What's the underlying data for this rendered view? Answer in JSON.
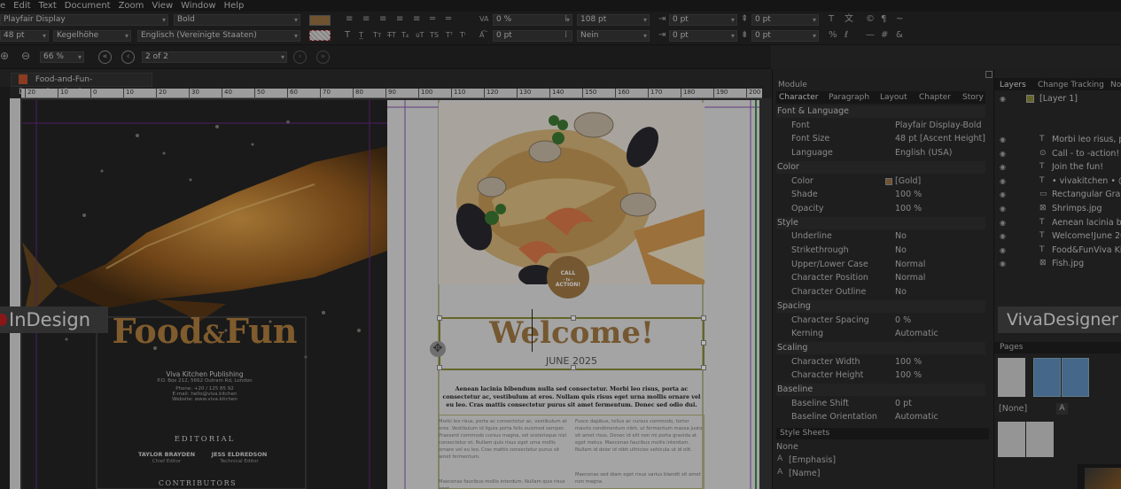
{
  "menu": [
    "Edit",
    "Text",
    "Document",
    "Zoom",
    "View",
    "Window",
    "Help"
  ],
  "menu_first_partial": "e",
  "toolbar": {
    "font": "Playfair Display",
    "style": "Bold",
    "size": "48 pt",
    "height_mode": "Kegelhöhe",
    "language": "Englisch (Vereinigte Staaten)",
    "tracking": "0 %",
    "leading": "108 pt",
    "indent1": "0 pt",
    "indent2": "0 pt",
    "indent3": "0 pt",
    "indent4": "0 pt",
    "baseline": "0 pt",
    "hyphen": "Nein",
    "swatch_color": "#9a7443"
  },
  "nav": {
    "zoom": "66 %",
    "page": "2 of 2"
  },
  "doc_tab": "Food-and-Fun-December.desd",
  "ruler_marks": [
    "20",
    "10",
    "0",
    "10",
    "20",
    "30",
    "40",
    "50",
    "60",
    "70",
    "80",
    "90",
    "100",
    "110",
    "120",
    "130",
    "140",
    "150",
    "160",
    "170",
    "180",
    "190",
    "200"
  ],
  "left_page": {
    "title_a": "Food",
    "title_amp": "&",
    "title_b": "Fun",
    "publisher": "Viva Kitchen Publishing",
    "address": "P.O. Box 212, 5662 Outram Rd, London",
    "phone": "Phone: +20 / 125 85 92",
    "email": "E-mail: hello@viva.kitchen",
    "web": "Website: www.viva.kitchen",
    "editorial": "EDITORIAL",
    "person1": "TAYLOR BRAYDEN",
    "role1": "Chief Editor",
    "person2": "JESS ELDREDSON",
    "role2": "Technical Editor",
    "contributors": "CONTRIBUTORS"
  },
  "right_page": {
    "cta_1": "CALL",
    "cta_2": "- to -",
    "cta_3": "ACTION!",
    "headline": "Welcome!",
    "date": "JUNE 2025",
    "intro": "Aenean lacinia bibendum nulla sed consectetur. Morbi leo risus, porta ac consectetur ac, vestibulum at eros. Nullam quis risus eget urna mollis ornare vel eu leo. Cras mattis consectetur purus sit amet fermentum. Donec sed odio dui.",
    "body_col1": "Morbi leo risus, porta ac consectetur ac, vestibulum at eros. Vestibulum id ligula porta felis euismod semper. Praesent commodo cursus magna, vel scelerisque nisl consectetur et. Nullam quis risus eget urna mollis ornare vel eu leo. Cras mattis consectetur purus sit amet fermentum.",
    "body_col2": "Fusce dapibus, tellus ac cursus commodo, tortor mauris condimentum nibh, ut fermentum massa justo sit amet risus. Donec id elit non mi porta gravida at eget metus. Maecenas faucibus mollis interdum. Nullam id dolor id nibh ultricies vehicula ut id elit.",
    "body_col1b": "Maecenas faucibus mollis interdum. Nullam quis risus eget",
    "body_col2b": "Maecenas sed diam eget risus varius blandit sit amet non magna."
  },
  "tags": {
    "left": "InDesign",
    "right": "VivaDesigner"
  },
  "panel_mid": {
    "module_label": "Module",
    "tabs": [
      "Character",
      "Paragraph",
      "Layout",
      "Chapter",
      "Story"
    ],
    "sections": [
      {
        "title": "Font & Language",
        "rows": [
          [
            "Font",
            "Playfair Display-Bold"
          ],
          [
            "Font Size",
            "48 pt [Ascent Height]"
          ],
          [
            "Language",
            "English (USA)"
          ]
        ]
      },
      {
        "title": "Color",
        "rows": [
          [
            "Color",
            "[Gold]"
          ],
          [
            "Shade",
            "100 %"
          ],
          [
            "Opacity",
            "100 %"
          ]
        ]
      },
      {
        "title": "Style",
        "rows": [
          [
            "Underline",
            "No"
          ],
          [
            "Strikethrough",
            "No"
          ],
          [
            "Upper/Lower Case",
            "Normal"
          ],
          [
            "Character Position",
            "Normal"
          ],
          [
            "Character Outline",
            "No"
          ]
        ]
      },
      {
        "title": "Spacing",
        "rows": [
          [
            "Character Spacing",
            "0 %"
          ],
          [
            "Kerning",
            "Automatic"
          ]
        ]
      },
      {
        "title": "Scaling",
        "rows": [
          [
            "Character Width",
            "100 %"
          ],
          [
            "Character Height",
            "100 %"
          ]
        ]
      },
      {
        "title": "Baseline",
        "rows": [
          [
            "Baseline Shift",
            "0 pt"
          ],
          [
            "Baseline Orientation",
            "Automatic"
          ]
        ]
      }
    ],
    "stylesheets_title": "Style Sheets",
    "stylesheets": [
      "None",
      "[Emphasis]",
      "[Name]"
    ]
  },
  "panel_right": {
    "tabs": [
      "Layers",
      "Change Tracking",
      "No"
    ],
    "layer0": "[Layer 1]",
    "items": [
      "Morbi leo risus, po",
      "Call - to -action!",
      "Join the fun!",
      "• vivakitchen • @v",
      "Rectangular Graph",
      "Shrimps.jpg",
      "Aenean lacinia bib",
      "Welcome!June 202",
      "Food&FunViva Kit",
      "Fish.jpg"
    ],
    "pages_title": "Pages",
    "master_label": "[None]",
    "master_letter": "A"
  }
}
